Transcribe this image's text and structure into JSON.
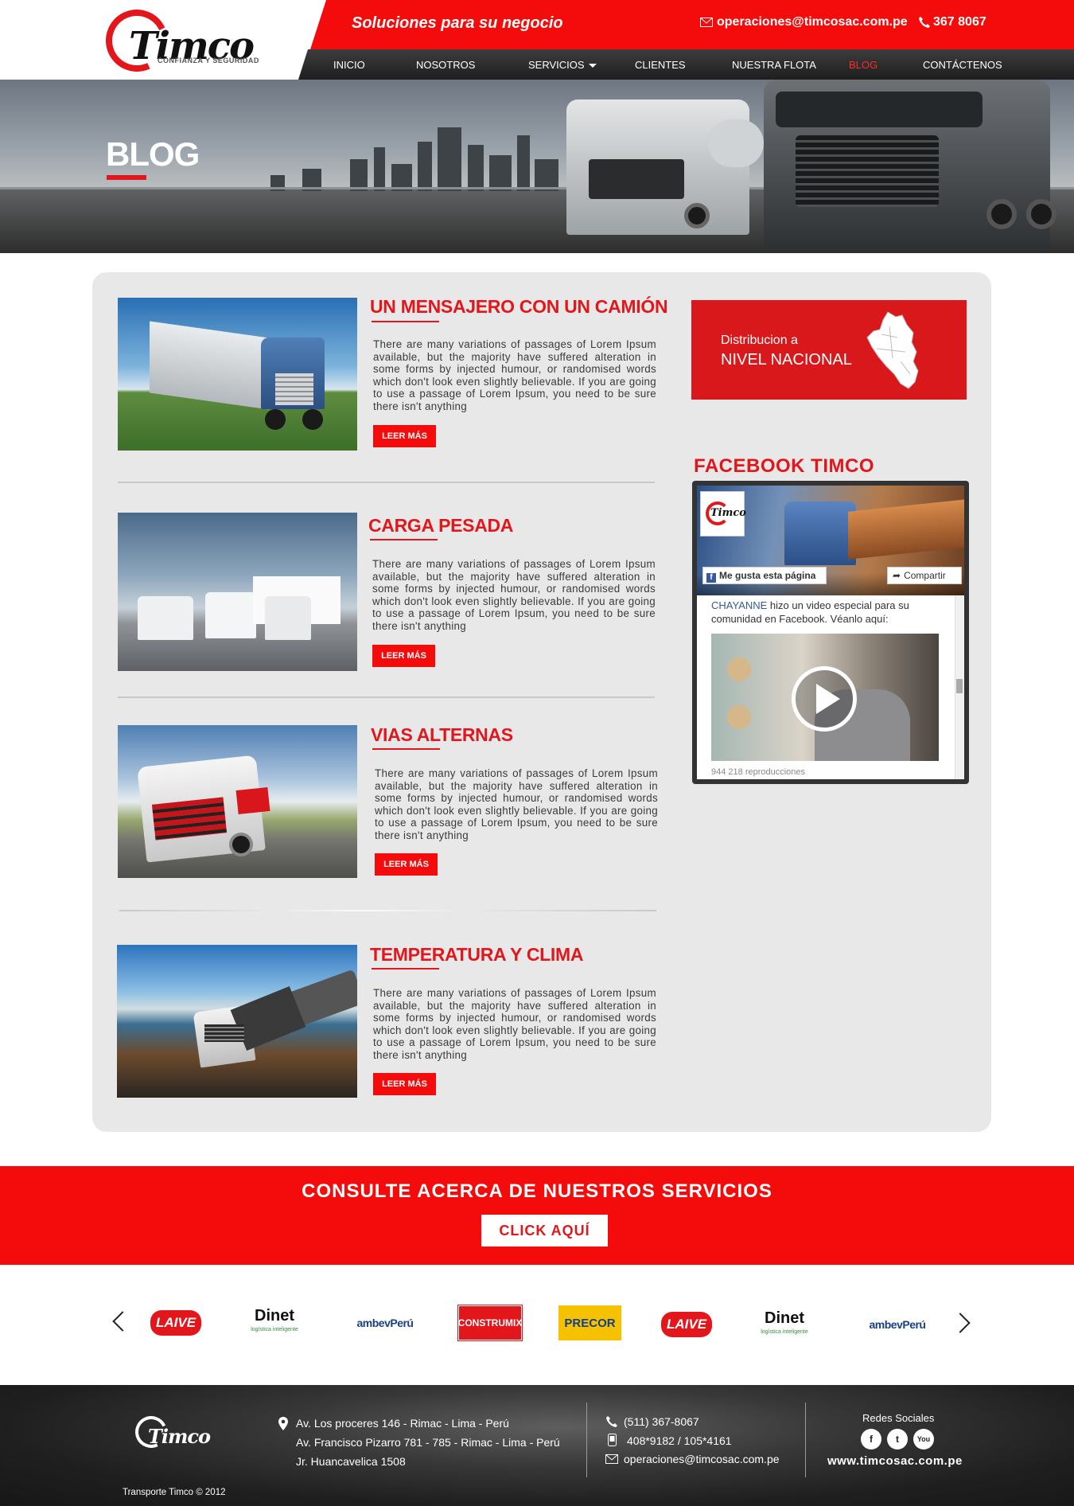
{
  "header": {
    "slogan": "Soluciones  para  su negocio",
    "email": "operaciones@timcosac.com.pe",
    "phone": "367 8067",
    "logo": {
      "word": "Timco",
      "tagline": "CONFIANZA Y SEGURIDAD"
    }
  },
  "nav": {
    "items": [
      "INICIO",
      "NOSOTROS",
      "SERVICIOS",
      "CLIENTES",
      "NUESTRA FLOTA",
      "BLOG",
      "CONTÁCTENOS"
    ],
    "active": "BLOG"
  },
  "hero": {
    "title": "BLOG"
  },
  "posts": [
    {
      "title": "UN MENSAJERO CON UN CAMIÓN",
      "body": "There are many variations of passages of Lorem Ipsum available, but the majority have suffered alteration in some forms by injected humour, or randomised words which don't look even slightly believable. If you are going to use a passage of Lorem Ipsum, you need to be sure there isn't anything",
      "button": "LEER MÁS"
    },
    {
      "title": "CARGA PESADA",
      "body": "There are many variations of passages of Lorem Ipsum available, but the majority have suffered alteration in some forms by injected humour, or randomised words which don't look even slightly believable. If you are going to use a passage of Lorem Ipsum, you need to be sure there isn't anything",
      "button": "LEER MÁS"
    },
    {
      "title": "VIAS ALTERNAS",
      "body": "There are many variations of passages of Lorem Ipsum available, but the majority have suffered alteration in some forms by injected humour, or randomised words which don't look even slightly believable. If you are going to use a passage of Lorem Ipsum, you need to be sure there isn't anything",
      "button": "LEER MÁS"
    },
    {
      "title": "TEMPERATURA Y CLIMA",
      "body": "There are many variations of passages of Lorem Ipsum available, but the majority have suffered alteration in some forms by injected humour, or randomised words which don't look even slightly believable. If you are going to use a passage of Lorem Ipsum, you need to be sure there isn't anything",
      "button": "LEER MÁS"
    }
  ],
  "sidebar": {
    "distribution": {
      "line1": "Distribucion a",
      "line2": "NIVEL NACIONAL"
    },
    "facebook": {
      "title": "FACEBOOK TIMCO",
      "like_button": "Me gusta esta página",
      "share_button": "Compartir",
      "post_author": "CHAYANNE",
      "post_text": " hizo un video especial para su comunidad en Facebook. Véanlo aquí:",
      "views": "944 218 reproducciones"
    }
  },
  "cta": {
    "title": "CONSULTE ACERCA DE NUESTROS SERVICIOS",
    "button": "CLICK AQUÍ"
  },
  "clients": [
    "LAIVE",
    "Dinet",
    "ambevPerú",
    "CONSTRUMIX",
    "PRECOR",
    "LAIVE",
    "Dinet",
    "ambevPerú"
  ],
  "clients_dinet_sub": "logística inteligente",
  "footer": {
    "addresses": [
      "Av. Los proceres 146 - Rimac - Lima - Perú",
      "Av. Francisco Pizarro 781 - 785 - Rimac - Lima - Perú",
      "Jr. Huancavelica 1508"
    ],
    "phone": "(511) 367-8067",
    "mobile": "408*9182 / 105*4161",
    "email": "operaciones@timcosac.com.pe",
    "social_title": "Redes Sociales",
    "social": [
      "f",
      "t",
      "You"
    ],
    "website": "www.timcosac.com.pe",
    "copyright": "Transporte Timco © 2012"
  },
  "colors": {
    "brand_red": "#f40b0b",
    "dark": "#1e1e1e",
    "panel": "#e8e8e8"
  },
  "icons": [
    "mail-icon",
    "phone-icon",
    "location-icon",
    "mobile-icon",
    "facebook-icon",
    "twitter-icon",
    "youtube-icon",
    "play-icon",
    "chevron-left-icon",
    "chevron-right-icon",
    "peru-map-icon"
  ]
}
